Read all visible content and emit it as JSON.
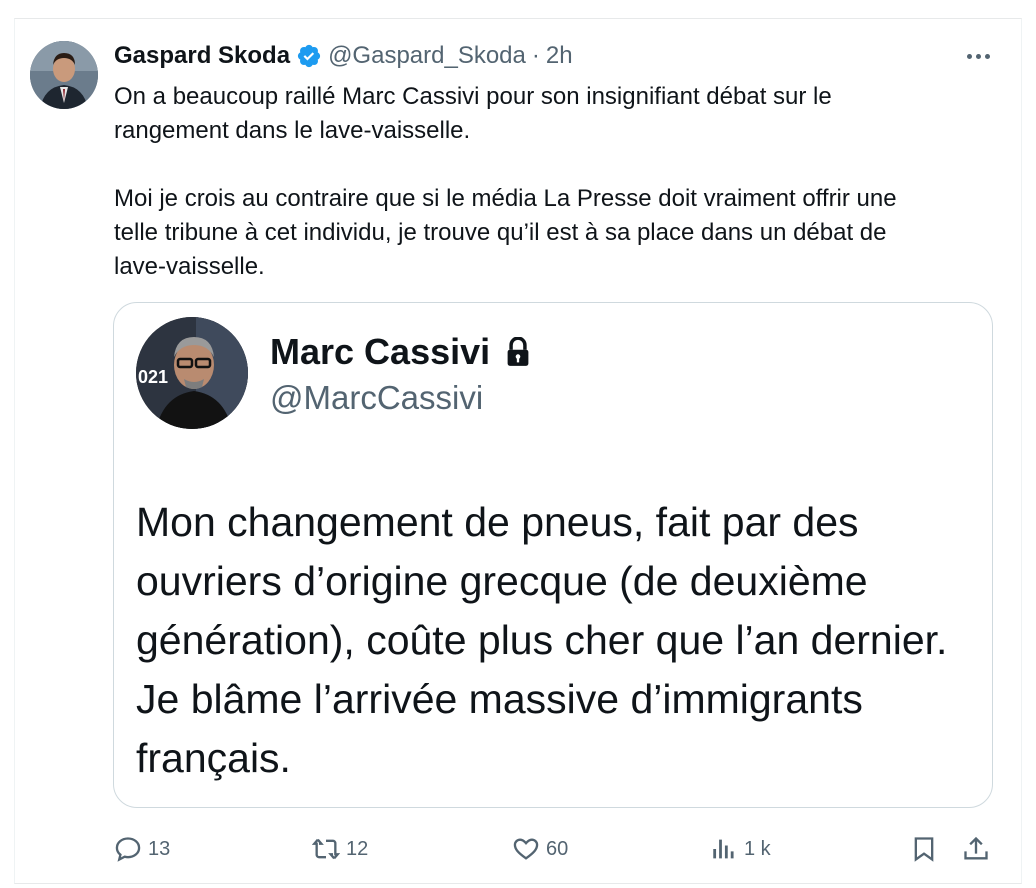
{
  "tweet": {
    "author_name": "Gaspard Skoda",
    "handle": "@Gaspard_Skoda",
    "separator": "·",
    "time": "2h",
    "text": "On a beaucoup raillé Marc Cassivi pour son insignifiant débat sur le\nrangement dans le lave-vaisselle.\n\nMoi je crois au contraire que si le média La Presse doit vraiment offrir une\ntelle tribune à cet individu, je trouve qu’il est à sa place dans un débat de\nlave-vaisselle."
  },
  "quote": {
    "author_name": "Marc Cassivi",
    "handle": "@MarcCassivi",
    "avatar_overlay_text": "021",
    "text": "Mon changement de pneus, fait par des\nouvriers d’origine grecque (de deuxième\ngénération), coûte plus cher que l’an dernier.\nJe blâme l’arrivée massive d’immigrants\nfrançais."
  },
  "actions": {
    "replies": "13",
    "reposts": "12",
    "likes": "60",
    "views": "1 k"
  },
  "colors": {
    "verified": "#1d9bf0",
    "secondary_text": "#536471",
    "border": "#cfd9de"
  },
  "icons": [
    "verified-badge-icon",
    "more-icon",
    "lock-icon",
    "reply-icon",
    "repost-icon",
    "like-icon",
    "views-icon",
    "bookmark-icon",
    "share-icon"
  ]
}
